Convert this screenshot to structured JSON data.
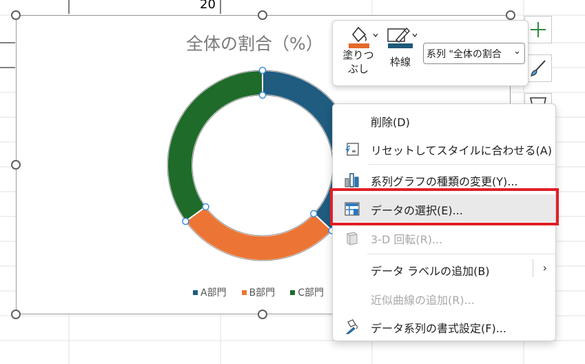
{
  "worksheet": {
    "cell_value": "20"
  },
  "chart": {
    "title": "全体の割合（%）"
  },
  "chart_data": {
    "type": "pie",
    "title": "全体の割合（%）",
    "categories": [
      "A部門",
      "B部門",
      "C部門"
    ],
    "values": [
      37,
      28,
      35
    ],
    "colors": [
      "#1f5c80",
      "#ec7535",
      "#1e6b2a"
    ],
    "legend": "bottom"
  },
  "mini_toolbar": {
    "fill_label_line1": "塗りつ",
    "fill_label_line2": "ぶし",
    "outline_label": "枠線",
    "series_select": "系列 \"全体の割合",
    "fill_color": "#e5692a",
    "outline_color": "#1f5a78"
  },
  "context_menu": {
    "items": [
      {
        "label": "削除(D)",
        "icon": "none"
      },
      {
        "label": "リセットしてスタイルに合わせる(A)",
        "icon": "reset-style-icon"
      },
      {
        "label": "系列グラフの種類の変更(Y)...",
        "icon": "chart-type-icon"
      },
      {
        "label": "データの選択(E)...",
        "icon": "select-data-icon"
      },
      {
        "label": "3-D 回転(R)...",
        "icon": "rotate-3d-icon"
      },
      {
        "label": "データ ラベルの追加(B)",
        "icon": "none"
      },
      {
        "label": "近似曲線の追加(R)...",
        "icon": "none"
      },
      {
        "label": "データ系列の書式設定(F)...",
        "icon": "format-series-icon"
      }
    ]
  },
  "side_buttons": [
    "plus-icon",
    "brush-icon",
    "filter-icon"
  ]
}
